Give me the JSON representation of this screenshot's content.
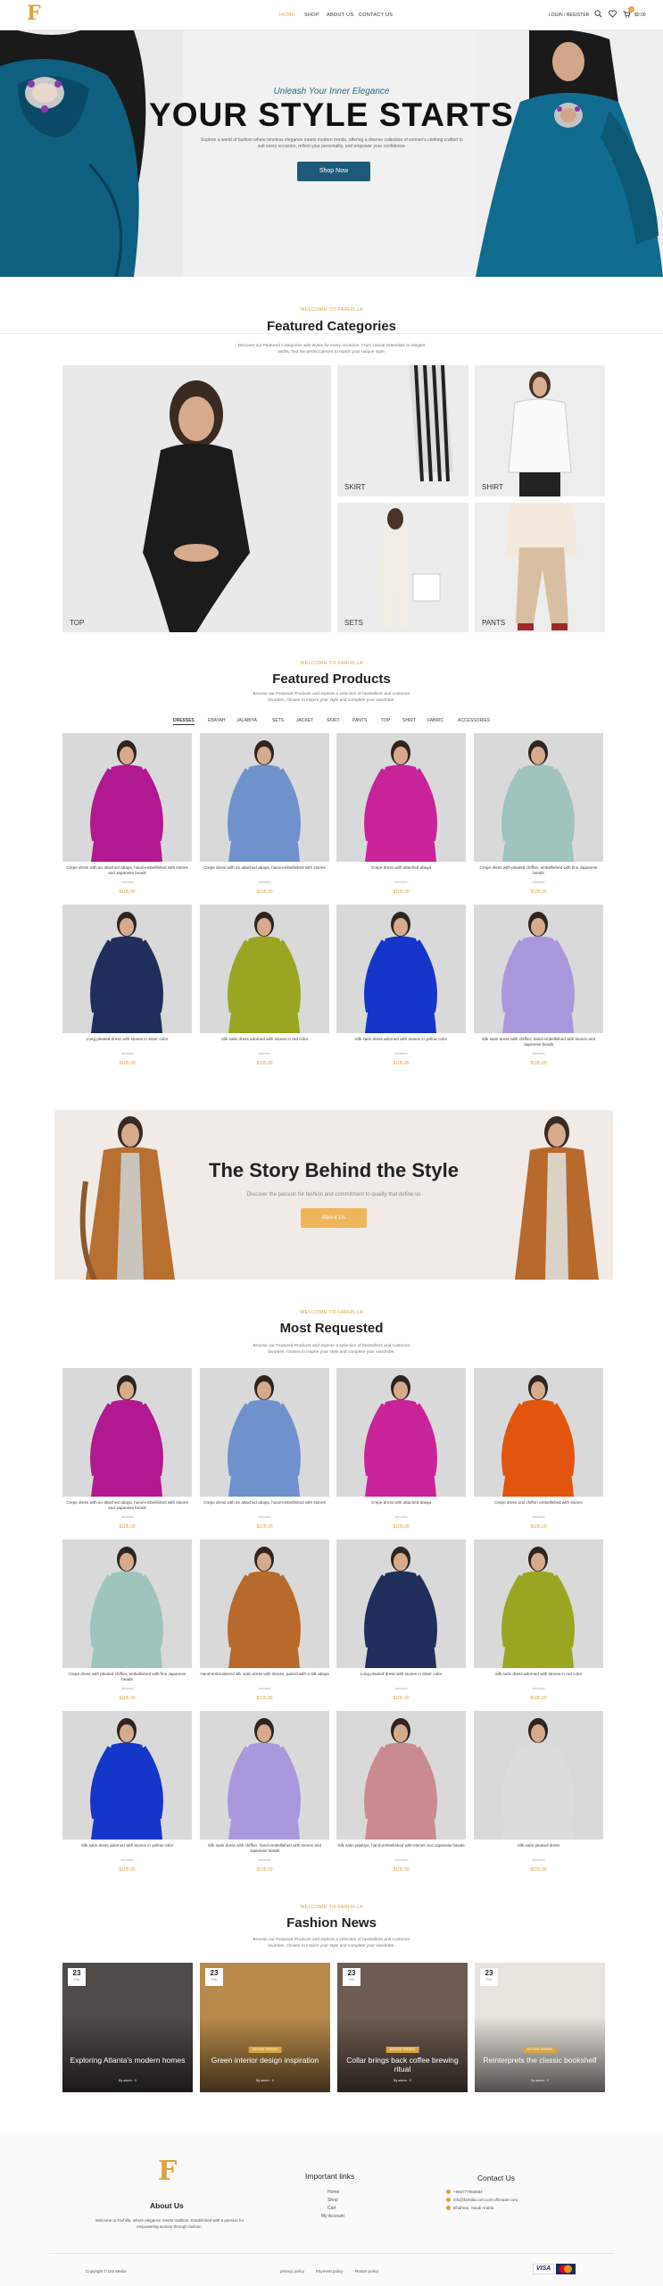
{
  "header": {
    "logo_letter": "F",
    "nav": [
      "HOME",
      "SHOP",
      "ABOUT US",
      "CONTACT US"
    ],
    "login": "LOGIN / REGISTER",
    "cart_count": "0",
    "cart_total": "$0.00"
  },
  "hero": {
    "subtitle": "Unleash Your Inner Elegance",
    "title": "YOUR STYLE STARTS",
    "description": "Explore a world of fashion where timeless elegance meets modern trends, offering a diverse collection of women's clothing crafted to suit every occasion, reflect your personality, and empower your confidence.",
    "button": "Shop Now"
  },
  "categories": {
    "kicker": "WELCOME TO FARHILLA",
    "title": "Featured Categories",
    "description": "Discover our Featured Categories with styles for every occasion. From casual essentials to elegant outfits, find the perfect pieces to match your unique style.",
    "items": [
      "TOP",
      "SKIRT",
      "SHIRT",
      "SETS",
      "PANTS"
    ]
  },
  "featured_products": {
    "kicker": "WELCOME TO FARHILLA",
    "title": "Featured Products",
    "description": "Browse our Featured Products and explore a selection of bestsellers and customer favorites, chosen to inspire your style and complete your wardrobe.",
    "tabs": [
      "DRESSES",
      "EBAYAH",
      "JALABIYA",
      "SETS",
      "JACKET",
      "SKIRT",
      "PANTS",
      "TOP",
      "SHIRT",
      "FABRIC",
      "ACCESSORIES"
    ],
    "active_tab": "DRESSES",
    "products": [
      {
        "name": "Crepe dress with an attached abaya, hand-embellished with stones and Japanese beads",
        "brand": "Ambera",
        "price": "$105.00",
        "color": "#b2188f"
      },
      {
        "name": "Crepe dress with an attached abaya, hand-embellished with stones",
        "brand": "Ambera",
        "price": "$105.00",
        "color": "#6f92cc"
      },
      {
        "name": "Crepe dress with attached abaya",
        "brand": "Ambera",
        "price": "$105.00",
        "color": "#c9239a"
      },
      {
        "name": "Crepe dress with pleated chiffon, embellished with fine Japanese beads",
        "brand": "Ambera",
        "price": "$105.00",
        "color": "#9fc3bd"
      },
      {
        "name": "Long pleated dress with stones in silver color",
        "brand": "Ambera",
        "price": "$105.00",
        "color": "#1f2e5a"
      },
      {
        "name": "Silk satin dress adorned with stones in red color",
        "brand": "Ambera",
        "price": "$105.00",
        "color": "#9aa521"
      },
      {
        "name": "Silk satin dress adorned with stones in yellow color",
        "brand": "Ambera",
        "price": "$105.00",
        "color": "#1436c9"
      },
      {
        "name": "Silk satin dress with chiffon, hand-embellished with stones and Japanese beads",
        "brand": "Ambera",
        "price": "$105.00",
        "color": "#a999dc"
      }
    ]
  },
  "story": {
    "title": "The Story Behind the Style",
    "description": "Discover the passion for fashion and commitment to quality that define us",
    "button": "About Us"
  },
  "most_requested": {
    "kicker": "WELCOME TO FARHILLA",
    "title": "Most Requested",
    "description": "Browse our Featured Products and explore a selection of bestsellers and customer favorites, chosen to inspire your style and complete your wardrobe.",
    "products": [
      {
        "name": "Crepe dress with an attached abaya, hand-embellished with stones and Japanese beads",
        "brand": "Ambera",
        "price": "$105.00",
        "color": "#b2188f"
      },
      {
        "name": "Crepe dress with an attached abaya, hand-embellished with stones",
        "brand": "Ambera",
        "price": "$105.00",
        "color": "#6f92cc"
      },
      {
        "name": "Crepe dress with attached abaya",
        "brand": "Ambera",
        "price": "$105.00",
        "color": "#c9239a"
      },
      {
        "name": "Crepe dress and chiffon embellished with stones",
        "brand": "Ambera",
        "price": "$105.00",
        "color": "#e2550e"
      },
      {
        "name": "Crepe dress with pleated chiffon, embellished with fine Japanese beads",
        "brand": "Ambera",
        "price": "$105.00",
        "color": "#9fc3bd"
      },
      {
        "name": "Hand-embroidered silk satin dress with stones, paired with a silk abaya",
        "brand": "Ambera",
        "price": "$105.00",
        "color": "#b86a2c"
      },
      {
        "name": "Long pleated dress with stones in silver color",
        "brand": "Ambera",
        "price": "$105.00",
        "color": "#1f2e5a"
      },
      {
        "name": "Silk satin dress adorned with stones in red color",
        "brand": "Ambera",
        "price": "$105.00",
        "color": "#9aa521"
      },
      {
        "name": "Silk satin dress adorned with stones in yellow color",
        "brand": "Ambera",
        "price": "$105.00",
        "color": "#1436c9"
      },
      {
        "name": "Silk satin dress with chiffon, hand-embellished with stones and Japanese beads",
        "brand": "Ambera",
        "price": "$105.00",
        "color": "#a999dc"
      },
      {
        "name": "Silk satin jalabiya, hand-embellished with stones and Japanese beads",
        "brand": "Ambera",
        "price": "$105.00",
        "color": "#c98a92"
      },
      {
        "name": "Silk satin pleated dress",
        "brand": "Ambera",
        "price": "$105.00",
        "color": "#dcdcdc"
      }
    ]
  },
  "news": {
    "kicker": "WELCOME TO FARHILLA",
    "title": "Fashion News",
    "description": "Browse our Featured Products and explore a selection of bestsellers and customer favorites, chosen to inspire your style and complete your wardrobe.",
    "posts": [
      {
        "day": "23",
        "month": "Feb",
        "tag": "",
        "title": "Exploring Atlanta's modern homes",
        "meta": "By admin  ·  0"
      },
      {
        "day": "23",
        "month": "Feb",
        "tag": "DESIGN TRENDS",
        "title": "Green interior design inspiration",
        "meta": "By admin  ·  0"
      },
      {
        "day": "23",
        "month": "Feb",
        "tag": "DESIGN TRENDS",
        "title": "Collar brings back coffee brewing ritual",
        "meta": "By admin  ·  0"
      },
      {
        "day": "23",
        "month": "Feb",
        "tag": "DESIGN TRENDS",
        "title": "Reinterprets the classic bookshelf",
        "meta": "By admin  ·  0"
      }
    ]
  },
  "footer": {
    "about_title": "About Us",
    "about_text": "Welcome to Farhilla, where elegance meets tradition. Established with a passion for empowering women through fashion.",
    "links_title": "Important links",
    "links": [
      "Home",
      "Shop",
      "Cart",
      "My Account"
    ],
    "contact_title": "Contact Us",
    "contact": [
      "+966777666584",
      "info@farhilla.com.com-dhrvade.com",
      "Dhahran, Saudi Arabia"
    ],
    "copyright": "Copyright © Dot Media",
    "bottom_links": [
      "privacy policy",
      "Payment policy",
      "Return policy"
    ],
    "payments": [
      "VISA",
      "mastercard"
    ]
  }
}
